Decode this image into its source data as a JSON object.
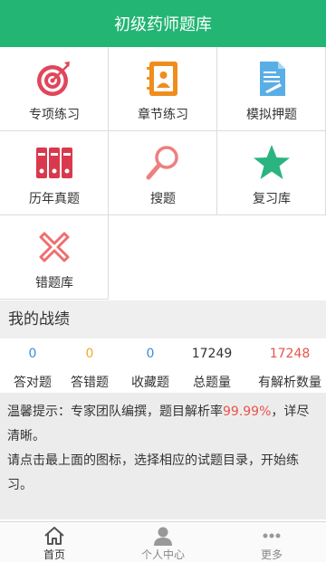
{
  "header": {
    "title": "初级药师题库"
  },
  "menu": [
    {
      "label": "专项练习",
      "icon": "target-icon"
    },
    {
      "label": "章节练习",
      "icon": "contacts-book-icon"
    },
    {
      "label": "模拟押题",
      "icon": "document-edit-icon"
    },
    {
      "label": "历年真题",
      "icon": "binders-icon"
    },
    {
      "label": "搜题",
      "icon": "search-icon"
    },
    {
      "label": "复习库",
      "icon": "star-icon"
    },
    {
      "label": "错题库",
      "icon": "cross-icon"
    }
  ],
  "stats_section": {
    "title": "我的战绩"
  },
  "stats": [
    {
      "value": "0",
      "label": "答对题",
      "color": "#3a8fd9"
    },
    {
      "value": "0",
      "label": "答错题",
      "color": "#f0a830"
    },
    {
      "value": "0",
      "label": "收藏题",
      "color": "#3a8fd9"
    },
    {
      "value": "17249",
      "label": "总题量",
      "color": "#333333"
    },
    {
      "value": "17248",
      "label": "有解析数量",
      "color": "#e8534c"
    }
  ],
  "tips": {
    "prefix": "温馨提示：专家团队编撰，题目解析率",
    "rate": "99.99%",
    "suffix": "，详尽清晰。",
    "line2": "请点击最上面的图标，选择相应的试题目录，开始练习。"
  },
  "tabbar": [
    {
      "label": "首页",
      "icon": "home-icon"
    },
    {
      "label": "个人中心",
      "icon": "user-icon"
    },
    {
      "label": "更多",
      "icon": "more-icon"
    }
  ],
  "colors": {
    "brand": "#22b573",
    "accent_red": "#e8534c",
    "blue": "#3a8fd9",
    "orange": "#f0a830"
  }
}
